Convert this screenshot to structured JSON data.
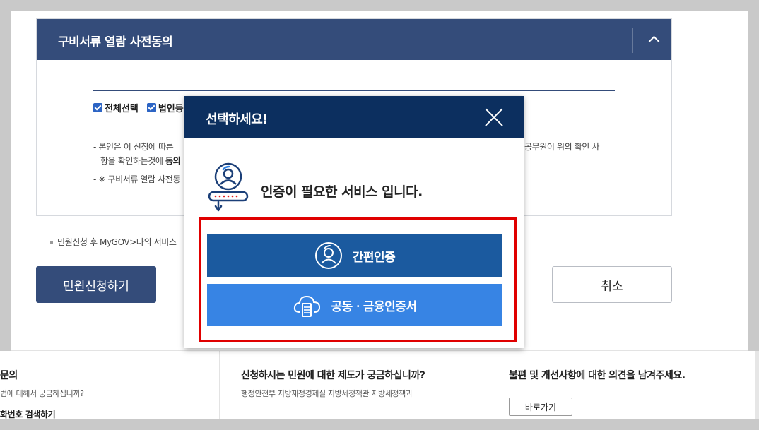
{
  "section": {
    "title": "구비서류 열람 사전동의",
    "checkboxes": [
      "전체선택",
      "법인등"
    ],
    "notice_1a": "본인은 이 신청에 따른 ",
    "notice_1b": "공무원이 위의 확인 사",
    "notice_2a": "항을 확인하는것에 ",
    "notice_2b": "동의",
    "notice_3": "※ 구비서류 열람 사전동"
  },
  "bullet_note": "민원신청 후 MyGOV>나의 서비스",
  "buttons": {
    "apply": "민원신청하기",
    "cancel": "취소"
  },
  "footer": {
    "col1": {
      "title": "문의",
      "sub": "법에 대해서 궁금하십니까?",
      "link": "화번호 검색하기"
    },
    "col2": {
      "title": "신청하시는 민원에 대한 제도가 궁금하십니까?",
      "sub": "행정안전부 지방재정경제실 지방세정책관 지방세정책과"
    },
    "col3": {
      "title": "불편 및 개선사항에 대한 의견을 남겨주세요.",
      "button": "바로가기"
    }
  },
  "modal": {
    "title": "선택하세요!",
    "message": "인증이 필요한 서비스 입니다.",
    "option_simple": "간편인증",
    "option_cert": "공동ㆍ금융인증서"
  },
  "colors": {
    "section_header": "#344c7a",
    "modal_header": "#0c2f5f",
    "option_simple": "#1b5a9f",
    "option_cert": "#3784e4",
    "highlight": "#e00000"
  }
}
